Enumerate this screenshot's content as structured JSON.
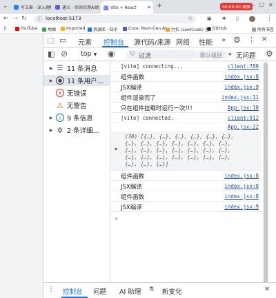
{
  "tabs": [
    {
      "title": "写文章 - 深入理解React"
    },
    {
      "title": "通义 - 你的实用AI助手"
    },
    {
      "title": "Vite + React"
    }
  ],
  "window": {
    "timer": "00:00:00 录屏"
  },
  "address": {
    "url": "localhost:5173"
  },
  "bookmarks": [
    {
      "label": "YouTube",
      "color": "#ff0000"
    },
    {
      "label": "地图",
      "color": "#34a853"
    },
    {
      "label": "Imported",
      "color": "#f4b400"
    },
    {
      "label": "资源库 · 知乎",
      "color": "#1772f6"
    },
    {
      "label": "Coze: Next-Gen AI...",
      "color": "#4d53e8"
    },
    {
      "label": "力扣 (LeetCode) 全...",
      "color": "#ffa116"
    },
    {
      "label": "GitHub",
      "color": "#24292f"
    }
  ],
  "bookmarks_all": "所有书签",
  "devtools": {
    "tabs": [
      "元素",
      "控制台",
      "源代码/来源",
      "网络",
      "性能"
    ],
    "more": "»",
    "errors_count": "1",
    "toolbar": {
      "context": "top",
      "filter_placeholder": "过滤",
      "levels": "默认级别",
      "issues": "无问题"
    },
    "sidebar": [
      {
        "label": "11 条消息"
      },
      {
        "label": "11 条用户..."
      },
      {
        "label": "无错误"
      },
      {
        "label": "无警告"
      },
      {
        "label": "9 条信息"
      },
      {
        "label": "2 条详细..."
      }
    ],
    "console": [
      {
        "text": "[vite] connecting...",
        "source": "client:789",
        "mono": true
      },
      {
        "text": "组件函数",
        "source": "index.jsx:8"
      },
      {
        "text": "JSX编译",
        "source": "index.jsx:9"
      },
      {
        "text": "组件渲染完了",
        "source": "index.jsx:11"
      },
      {
        "text": "只在组件挂载时运行一次!!!",
        "source": "App.jsx:18"
      },
      {
        "text": "[vite] connected.",
        "source": "client:912",
        "mono": true
      },
      {
        "text": "",
        "source": "App.jsx:22"
      }
    ],
    "array_preview": {
      "line1": "(30) [{…}, {…}, {…}, {…}, {…}, {…},",
      "line2": "{…}, {…}, {…}, {…}, {…}, {…}, {…},",
      "line3": "{…}, {…}, {…}, {…}, {…}, {…}, {…},",
      "line4": "{…}, {…}, {…}, {…}, {…}, {…}, {…},",
      "line5": "{…}, {…}, {…}]"
    },
    "console_after": [
      {
        "text": "组件函数",
        "source": "index.jsx:8"
      },
      {
        "text": "JSX编译",
        "source": "index.jsx:9"
      },
      {
        "text": "组件函数",
        "source": "index.jsx:8"
      },
      {
        "text": "JSX编译",
        "source": "index.jsx:9"
      }
    ],
    "prompt": "›",
    "drawer": {
      "tabs": [
        "控制台",
        "问题",
        "AI 助理",
        "新变化"
      ]
    }
  }
}
